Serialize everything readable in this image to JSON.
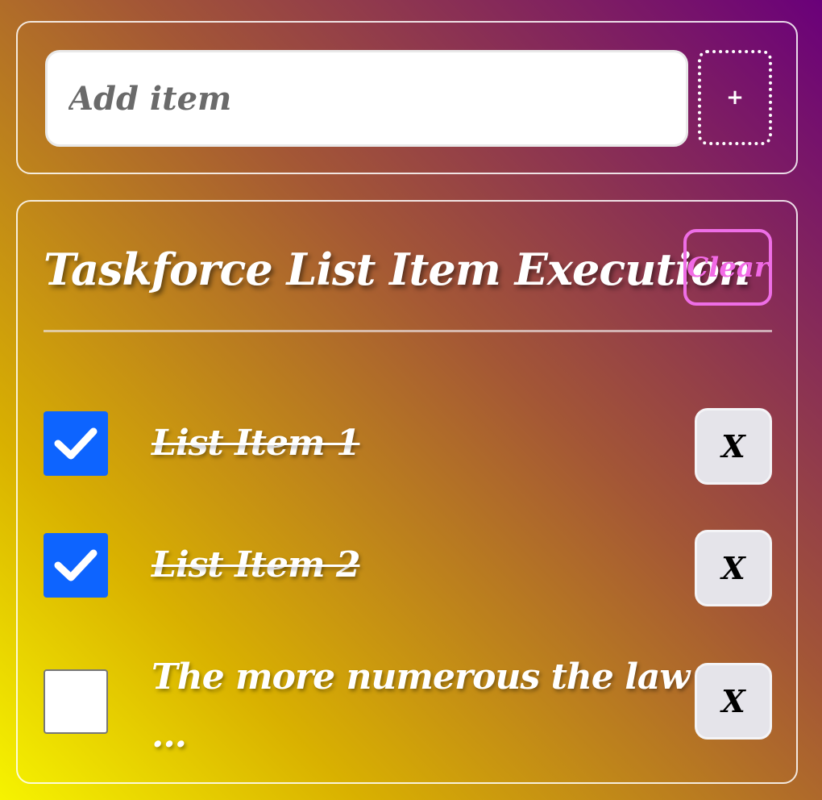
{
  "add_form": {
    "input_placeholder": "Add item",
    "input_value": "",
    "add_button_label": "+"
  },
  "list": {
    "title": "Taskforce List Item Execution",
    "clear_label": "Clear",
    "items": [
      {
        "text": "List Item 1",
        "checked": true,
        "delete_label": "X"
      },
      {
        "text": "List Item 2",
        "checked": true,
        "delete_label": "X"
      },
      {
        "text": "The more numerous the law",
        "continuation": "...",
        "checked": false,
        "delete_label": "X"
      }
    ]
  },
  "colors": {
    "checkbox_checked": "#0d64ff",
    "clear_accent": "#ee6ee6",
    "gradient_top_right": "#6a007a",
    "gradient_bottom_left": "#f6f300"
  },
  "icons": {
    "checkmark": "check-icon"
  }
}
